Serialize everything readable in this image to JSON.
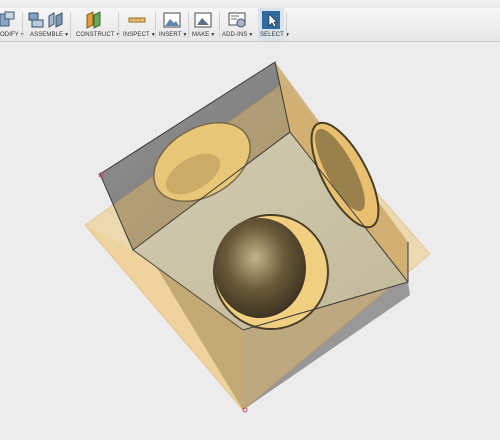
{
  "toolbar": {
    "modify": {
      "label": "ODIFY",
      "icon": "modify-icon"
    },
    "assemble": {
      "label": "ASSEMBLE",
      "icons": [
        "new-component-icon",
        "joint-icon"
      ]
    },
    "construct": {
      "label": "CONSTRUCT",
      "icon": "offset-plane-icon"
    },
    "inspect": {
      "label": "INSPECT",
      "icon": "measure-icon"
    },
    "insert": {
      "label": "INSERT",
      "icon": "insert-image-icon"
    },
    "make": {
      "label": "MAKE",
      "icon": "make-3d-print-icon"
    },
    "addins": {
      "label": "ADD-INS",
      "icon": "scripts-addins-icon"
    },
    "select": {
      "label": "SELECT",
      "icon": "select-cursor-icon"
    }
  },
  "colors": {
    "plane": "#f0c060",
    "cube_face": "#c9c0a3",
    "cube_shadow": "#7f7f7f",
    "select_active": "#d9e3ea"
  }
}
